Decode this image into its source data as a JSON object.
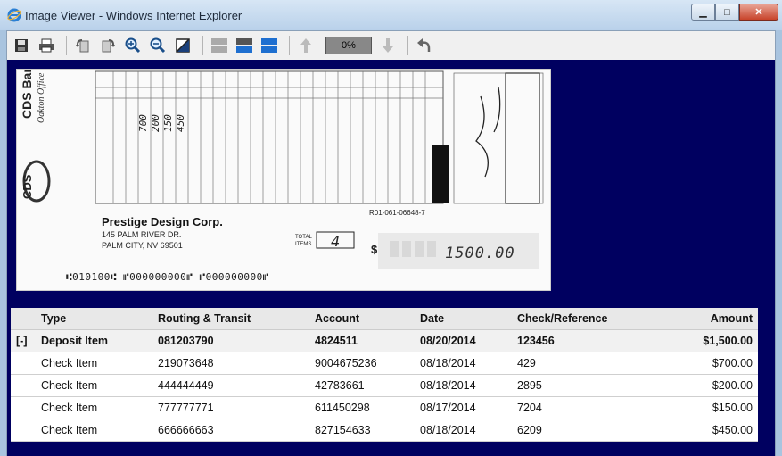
{
  "window": {
    "title": "Image Viewer - Windows Internet Explorer"
  },
  "toolbar": {
    "zoom_value": "0%",
    "icons": [
      "save-icon",
      "print-icon",
      "rotate-left-icon",
      "rotate-right-icon",
      "zoom-in-icon",
      "zoom-out-icon",
      "invert-icon",
      "layout-single-icon",
      "layout-top-icon",
      "layout-split-icon",
      "up-arrow-icon",
      "down-arrow-icon",
      "undo-icon"
    ]
  },
  "check": {
    "bank_name": "CDS Bank",
    "office": "Oakton Office",
    "company": "Prestige Design Corp.",
    "address1": "145 PALM RIVER DR.",
    "address2": "PALM CITY, NV 69501",
    "routing_label": "R01-061-06648-7",
    "total_items_label": "TOTAL ITEMS",
    "total_items_value": "4",
    "amount": "1500.00",
    "micr": "⑆010100⑆ ⑈000000000⑈ ⑈000000000⑈"
  },
  "table": {
    "headers": [
      "",
      "Type",
      "Routing & Transit",
      "Account",
      "Date",
      "Check/Reference",
      "Amount"
    ],
    "rows": [
      {
        "toggle": "[-]",
        "type": "Deposit Item",
        "routing": "081203790",
        "account": "4824511",
        "date": "08/20/2014",
        "ref": "123456",
        "amount": "$1,500.00"
      },
      {
        "toggle": "",
        "type": "Check Item",
        "routing": "219073648",
        "account": "9004675236",
        "date": "08/18/2014",
        "ref": "429",
        "amount": "$700.00"
      },
      {
        "toggle": "",
        "type": "Check Item",
        "routing": "444444449",
        "account": "42783661",
        "date": "08/18/2014",
        "ref": "2895",
        "amount": "$200.00"
      },
      {
        "toggle": "",
        "type": "Check Item",
        "routing": "777777771",
        "account": "611450298",
        "date": "08/17/2014",
        "ref": "7204",
        "amount": "$150.00"
      },
      {
        "toggle": "",
        "type": "Check Item",
        "routing": "666666663",
        "account": "827154633",
        "date": "08/18/2014",
        "ref": "6209",
        "amount": "$450.00"
      }
    ]
  }
}
